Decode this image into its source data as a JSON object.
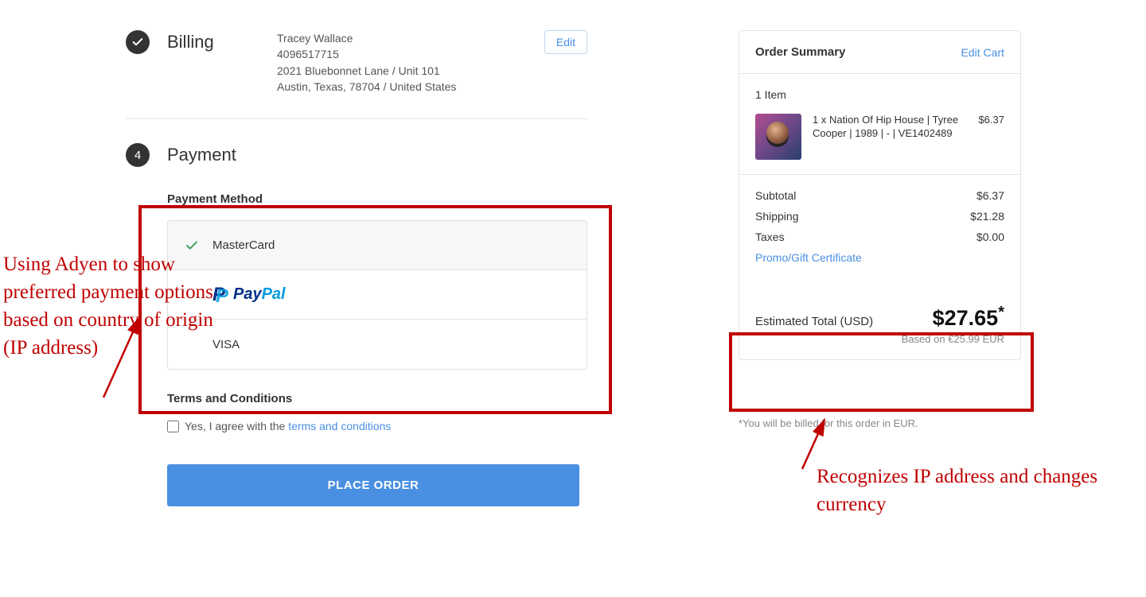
{
  "billing": {
    "title": "Billing",
    "name": "Tracey Wallace",
    "phone": "4096517715",
    "address1": "2021 Bluebonnet Lane / Unit 101",
    "address2": "Austin, Texas, 78704 / United States",
    "edit_label": "Edit"
  },
  "payment": {
    "step_number": "4",
    "title": "Payment",
    "method_heading": "Payment Method",
    "methods": {
      "mastercard": "MasterCard",
      "paypal_pay": "Pay",
      "paypal_pal": "Pal",
      "visa": "VISA"
    }
  },
  "terms": {
    "heading": "Terms and Conditions",
    "prefix": "Yes, I agree with the ",
    "link_text": "terms and conditions"
  },
  "place_order_label": "PLACE ORDER",
  "summary": {
    "title": "Order Summary",
    "edit_cart": "Edit Cart",
    "items_count": "1 Item",
    "item": {
      "name": "1 x Nation Of Hip House | Tyree Cooper | 1989 | - | VE1402489",
      "price": "$6.37"
    },
    "subtotal_label": "Subtotal",
    "subtotal_value": "$6.37",
    "shipping_label": "Shipping",
    "shipping_value": "$21.28",
    "taxes_label": "Taxes",
    "taxes_value": "$0.00",
    "promo_label": "Promo/Gift Certificate",
    "total_label": "Estimated Total (USD)",
    "total_value": "$27.65",
    "total_asterisk": "*",
    "total_sub": "Based on €25.99 EUR"
  },
  "billing_note": "*You will be billed for this order in EUR.",
  "annotations": {
    "left": "Using Adyen to show preferred payment options based on country of origin (IP address)",
    "right": "Recognizes IP address and changes currency"
  }
}
